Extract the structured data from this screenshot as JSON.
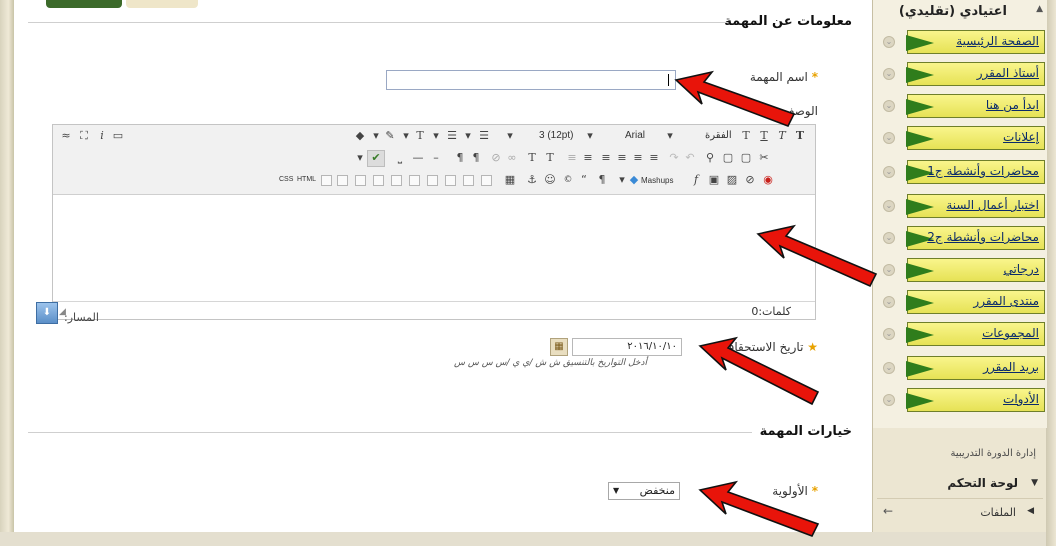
{
  "task_info": {
    "section_title": "معلومات عن المهمة",
    "name_label": "اسم المهمة",
    "name_required": "*",
    "name_value": "",
    "description_label": "الوصف",
    "due_date_label": "تاريخ الاستحقاق",
    "due_date_required": "★",
    "due_date_value": "٢٠١٦/١٠/١٠",
    "due_date_hint": "أدخل التواريخ بالتنسيق ش ش /ي ي /س س س س"
  },
  "editor": {
    "paragraph_label": "الفقرة",
    "font_label": "Arial",
    "size_label": "3 (12pt)",
    "mashups_label": "Mashups",
    "html_label": "HTML",
    "css_label": "CSS",
    "word_count_label": "كلمات:0",
    "path_label": "المسار:"
  },
  "task_options": {
    "section_title": "خيارات المهمة",
    "priority_label": "الأولوية",
    "priority_required": "*",
    "priority_value": "منخفض"
  },
  "sidebar": {
    "title": "اعتيادي (تقليدي)",
    "items": [
      {
        "label": "الصفحة الرئيسية"
      },
      {
        "label": "أستاذ المقرر"
      },
      {
        "label": "ابدأ من هنا"
      },
      {
        "label": "إعلانات"
      },
      {
        "label": "محاضرات وأنشطة ج1"
      },
      {
        "label": "اختبار أعمال السنة"
      },
      {
        "label": "محاضرات وأنشطة ج2"
      },
      {
        "label": "درجاتي"
      },
      {
        "label": "منتدى المقرر"
      },
      {
        "label": "المجموعات"
      },
      {
        "label": "بريد المقرر"
      },
      {
        "label": "الأدوات"
      }
    ],
    "course_management": "إدارة الدورة التدريبية",
    "control_panel": "لوحة التحكم",
    "files": "الملفات"
  },
  "colors": {
    "arrow_red": "#e8140a",
    "menu_yellow": "#f2ee72",
    "menu_green": "#2f7d1c",
    "required_star": "#e8a200"
  }
}
